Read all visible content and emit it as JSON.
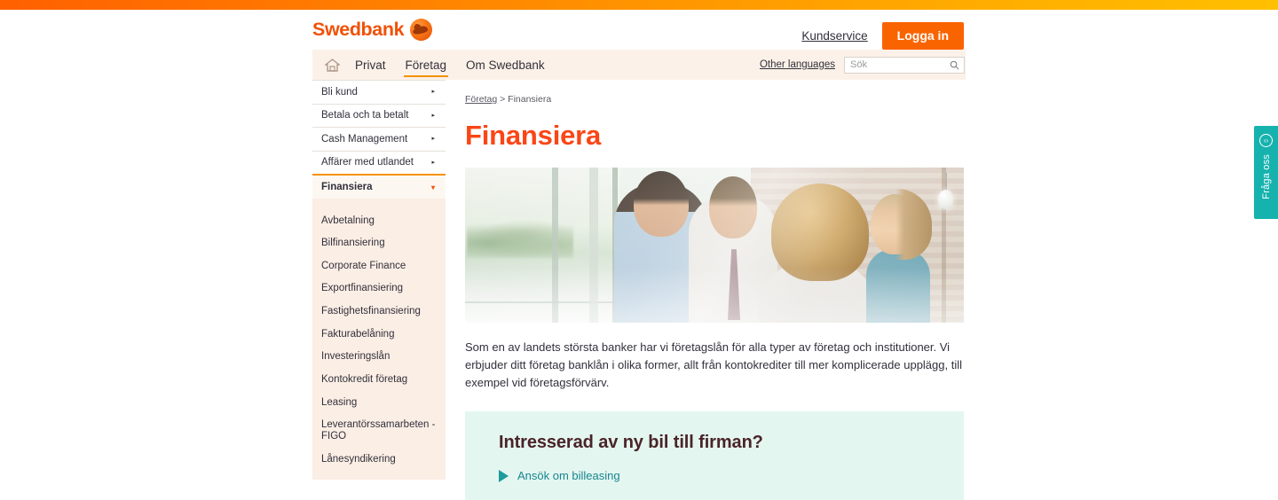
{
  "brand": {
    "name": "Swedbank",
    "logo_mark": "oak-leaf-circle-icon",
    "accent_orange": "#fa6400",
    "title_orange": "#fa4616",
    "teal": "#16b2ae",
    "promo_bg": "#e4f6f0"
  },
  "top_bar": {
    "gradient_from": "#ff6000",
    "gradient_to": "#ffc000"
  },
  "header": {
    "customer_service": "Kundservice",
    "login_button": "Logga in"
  },
  "nav": {
    "home_icon": "home-icon",
    "items": [
      {
        "label": "Privat",
        "active": false
      },
      {
        "label": "Företag",
        "active": true
      },
      {
        "label": "Om Swedbank",
        "active": false
      }
    ],
    "other_languages": "Other languages",
    "search": {
      "placeholder": "Sök",
      "value": "",
      "icon": "search-icon"
    }
  },
  "sidebar": {
    "top_items": [
      {
        "label": "Bli kund"
      },
      {
        "label": "Betala och ta betalt"
      },
      {
        "label": "Cash Management"
      },
      {
        "label": "Affärer med utlandet"
      }
    ],
    "arrow_glyph": "▸",
    "active_item": {
      "label": "Finansiera",
      "arrow_glyph": "▾"
    },
    "sub_items": [
      {
        "label": "Avbetalning"
      },
      {
        "label": "Bilfinansiering"
      },
      {
        "label": "Corporate Finance"
      },
      {
        "label": "Exportfinansiering"
      },
      {
        "label": "Fastighetsfinansiering"
      },
      {
        "label": "Fakturabelåning"
      },
      {
        "label": "Investeringslån"
      },
      {
        "label": "Kontokredit företag"
      },
      {
        "label": "Leasing"
      },
      {
        "label": "Leverantörssamarbeten - FIGO"
      },
      {
        "label": "Lånesyndikering"
      }
    ]
  },
  "content": {
    "breadcrumb": {
      "parent": "Företag",
      "separator": ">",
      "current": "Finansiera"
    },
    "title": "Finansiera",
    "hero_image_alt": "Fyra personer i affärskläder samtalar vid ett fönster på ett kontor",
    "intro": "Som en av landets största banker har vi företagslån för alla typer av företag och institutioner. Vi erbjuder ditt företag banklån i olika former, allt från kontokrediter till mer komplicerade upplägg, till exempel vid företagsförvärv.",
    "promo": {
      "title": "Intresserad av ny bil till firman?",
      "link_label": "Ansök om billeasing",
      "link_icon": "play-triangle-icon"
    }
  },
  "ask_tab": {
    "label": "Fråga oss",
    "icon": "chat-code-circle-icon",
    "icon_glyph": "‹›"
  }
}
